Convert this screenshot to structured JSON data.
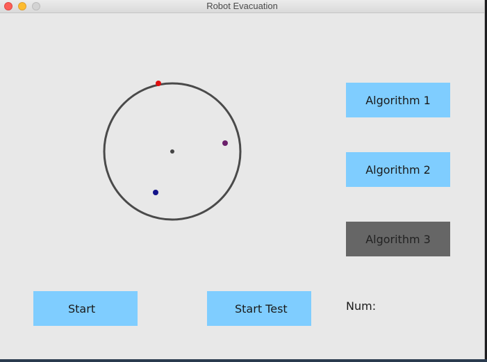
{
  "window": {
    "title": "Robot Evacuation"
  },
  "controls": {
    "algorithm_1": "Algorithm 1",
    "algorithm_2": "Algorithm 2",
    "algorithm_3": "Algorithm 3",
    "selected_algorithm": "Algorithm 3",
    "start": "Start",
    "start_test": "Start Test",
    "num_label": "Num:",
    "num_value": ""
  },
  "simulation": {
    "robots": [
      {
        "name": "robot-red",
        "color": "#e01010"
      },
      {
        "name": "robot-purple",
        "color": "#6a1f6a"
      },
      {
        "name": "robot-blue",
        "color": "#14148a"
      }
    ],
    "center_color": "#444444",
    "circle_color": "#4a4a4a"
  },
  "colors": {
    "button": "#7fcdff",
    "button_selected": "#666666",
    "background": "#e8e8e8"
  }
}
